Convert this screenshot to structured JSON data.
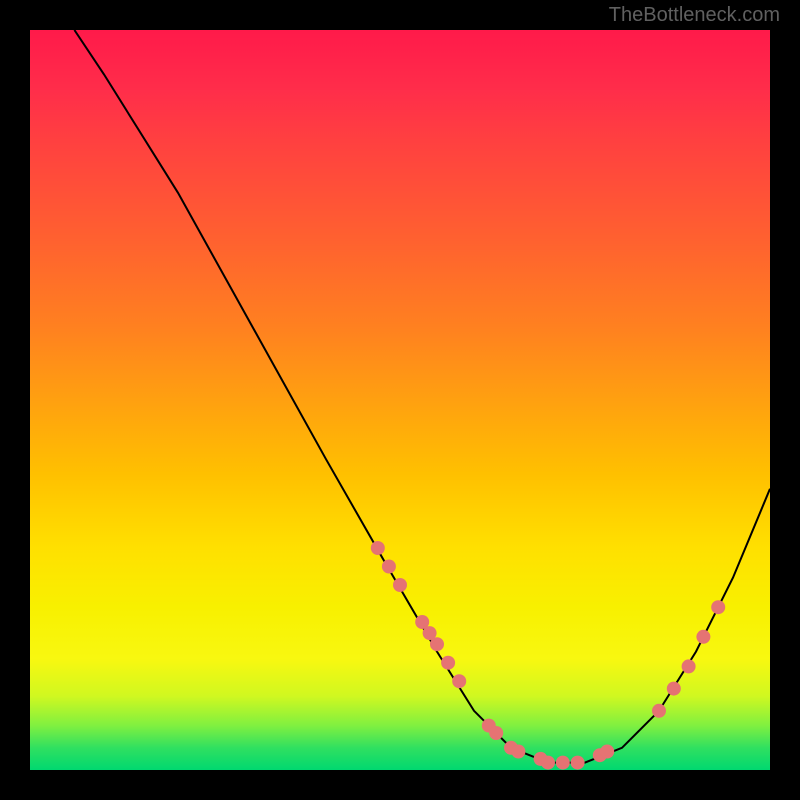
{
  "watermark": "TheBottleneck.com",
  "chart_data": {
    "type": "line",
    "title": "",
    "xlabel": "",
    "ylabel": "",
    "xlim": [
      0,
      100
    ],
    "ylim": [
      0,
      100
    ],
    "curve": [
      {
        "x": 6,
        "y": 100
      },
      {
        "x": 10,
        "y": 94
      },
      {
        "x": 20,
        "y": 78
      },
      {
        "x": 30,
        "y": 60
      },
      {
        "x": 40,
        "y": 42
      },
      {
        "x": 48,
        "y": 28
      },
      {
        "x": 55,
        "y": 16
      },
      {
        "x": 60,
        "y": 8
      },
      {
        "x": 65,
        "y": 3
      },
      {
        "x": 70,
        "y": 1
      },
      {
        "x": 75,
        "y": 1
      },
      {
        "x": 80,
        "y": 3
      },
      {
        "x": 85,
        "y": 8
      },
      {
        "x": 90,
        "y": 16
      },
      {
        "x": 95,
        "y": 26
      },
      {
        "x": 100,
        "y": 38
      }
    ],
    "markers": [
      {
        "x": 47,
        "y": 30
      },
      {
        "x": 48.5,
        "y": 27.5
      },
      {
        "x": 50,
        "y": 25
      },
      {
        "x": 53,
        "y": 20
      },
      {
        "x": 54,
        "y": 18.5
      },
      {
        "x": 55,
        "y": 17
      },
      {
        "x": 56.5,
        "y": 14.5
      },
      {
        "x": 58,
        "y": 12
      },
      {
        "x": 62,
        "y": 6
      },
      {
        "x": 63,
        "y": 5
      },
      {
        "x": 65,
        "y": 3
      },
      {
        "x": 66,
        "y": 2.5
      },
      {
        "x": 69,
        "y": 1.5
      },
      {
        "x": 70,
        "y": 1
      },
      {
        "x": 72,
        "y": 1
      },
      {
        "x": 74,
        "y": 1
      },
      {
        "x": 77,
        "y": 2
      },
      {
        "x": 78,
        "y": 2.5
      },
      {
        "x": 85,
        "y": 8
      },
      {
        "x": 87,
        "y": 11
      },
      {
        "x": 89,
        "y": 14
      },
      {
        "x": 91,
        "y": 18
      },
      {
        "x": 93,
        "y": 22
      }
    ],
    "marker_color": "#e57373",
    "curve_color": "#000000"
  }
}
